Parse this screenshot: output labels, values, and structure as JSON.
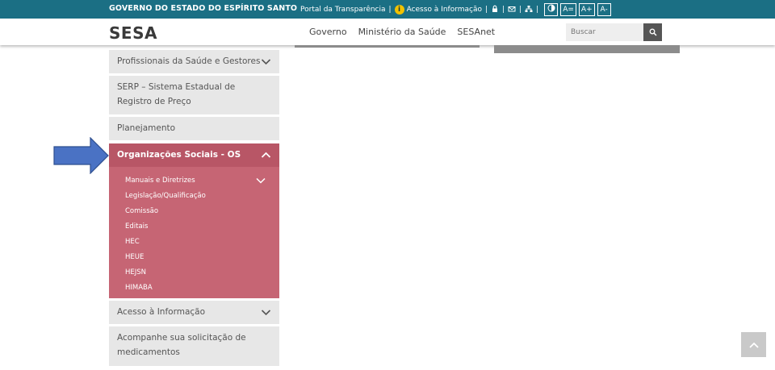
{
  "topbar": {
    "gov_title": "GOVERNO DO ESTADO DO ESPÍRITO SANTO",
    "portal_link": "Portal da Transparência",
    "info_link": "Acesso à Informação",
    "sep": "|",
    "font_reset": "A=",
    "font_increase": "A+",
    "font_decrease": "A-"
  },
  "header": {
    "logo": "SESA",
    "nav": [
      "Governo",
      "Ministério da Saúde",
      "SESAnet"
    ],
    "search_placeholder": "Buscar"
  },
  "menu": {
    "items": [
      {
        "label": "Profissionais da Saúde e Gestores",
        "has_chevron": true
      },
      {
        "label": "SERP – Sistema Estadual de Registro de Preço",
        "has_chevron": false
      },
      {
        "label": "Planejamento",
        "has_chevron": false
      },
      {
        "label": "Organizações Sociais - OS",
        "has_chevron": true,
        "expanded": true
      },
      {
        "label": "Acesso à Informação",
        "has_chevron": true
      },
      {
        "label": "Acompanhe sua solicitação de medicamentos",
        "has_chevron": false
      }
    ],
    "submenu": [
      "Manuais e Diretrizes",
      "Legislação/Qualificação",
      "Comissão",
      "Editais",
      "HEC",
      "HEUE",
      "HEJSN",
      "HIMABA"
    ]
  },
  "colors": {
    "topbar": "#1b6f84",
    "active_item": "#b85666",
    "submenu_bg": "#c66574",
    "arrow": "#4a72c4"
  }
}
